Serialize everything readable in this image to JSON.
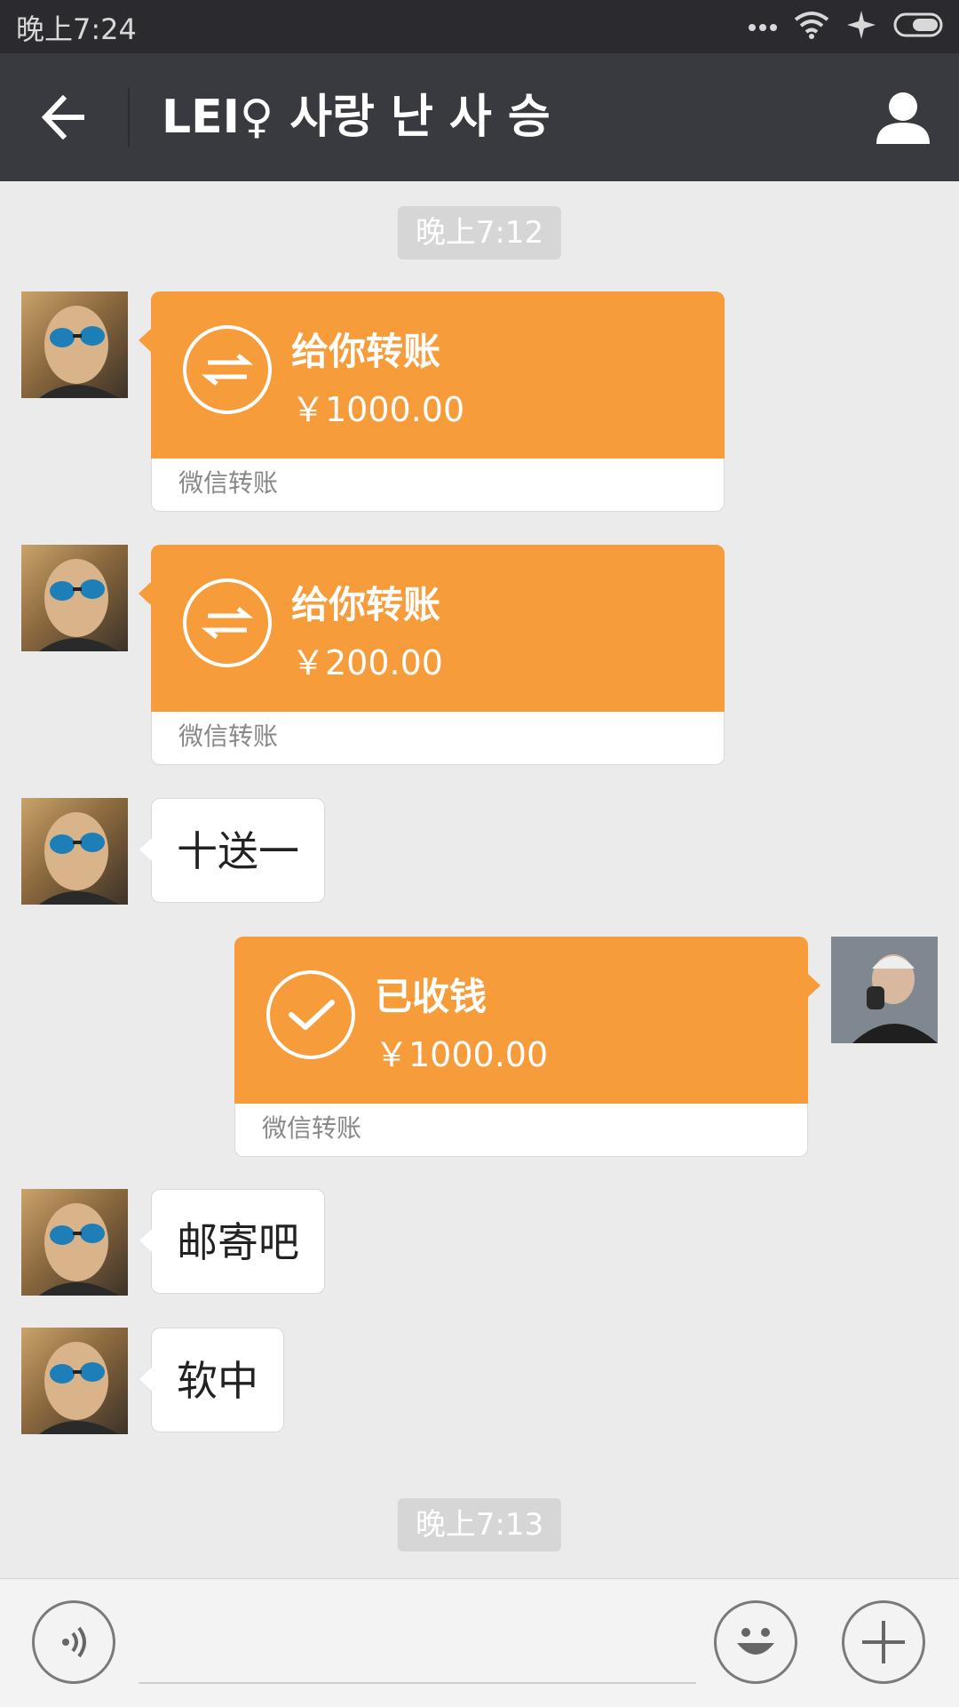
{
  "status_bar": {
    "time": "晚上7:24"
  },
  "header": {
    "title": "LEI♀ 사랑 난 사 승"
  },
  "messages": {
    "time_1": "晚上7:12",
    "transfer_1": {
      "title": "给你转账",
      "amount": "￥1000.00",
      "footer": "微信转账"
    },
    "transfer_2": {
      "title": "给你转账",
      "amount": "￥200.00",
      "footer": "微信转账"
    },
    "text_1": "十送一",
    "transfer_3": {
      "title": "已收钱",
      "amount": "￥1000.00",
      "footer": "微信转账"
    },
    "text_2": "邮寄吧",
    "text_3": "软中",
    "time_2": "晚上7:13"
  },
  "input_bar": {
    "value": "",
    "placeholder": ""
  },
  "colors": {
    "transfer_orange": "#f79c3a",
    "header_bg": "#393a3f",
    "chat_bg": "#ebebeb"
  }
}
